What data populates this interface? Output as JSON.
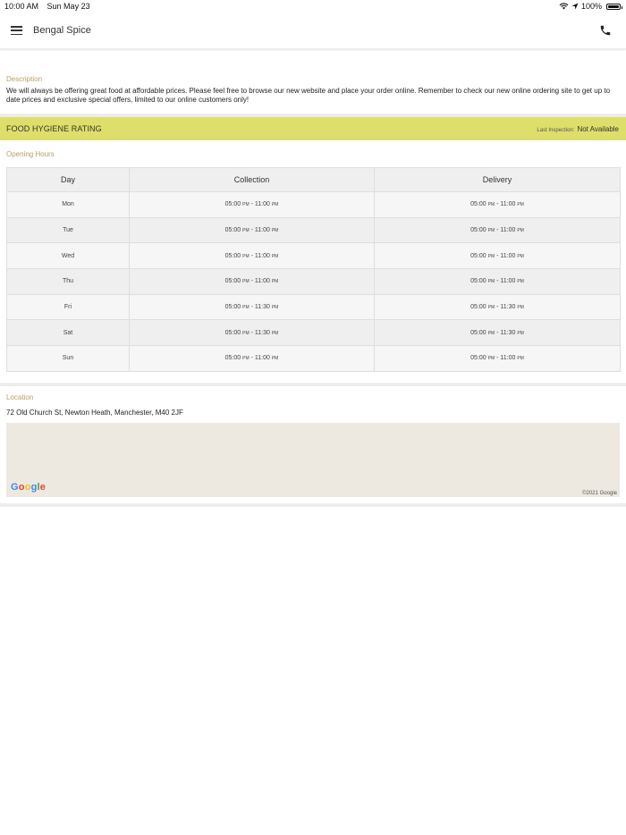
{
  "status_bar": {
    "time": "10:00 AM",
    "date": "Sun May 23",
    "battery": "100%",
    "icons": [
      "wifi-icon",
      "location-arrow-icon",
      "battery-icon"
    ]
  },
  "header": {
    "title": "Bengal Spice",
    "icons": [
      "hamburger-menu-icon",
      "phone-icon"
    ]
  },
  "description": {
    "label": "Description",
    "text": "We will always be offering great food at affordable prices. Please feel free to browse our new website and place your order online. Remember to check our new online ordering site to get up to date prices and exclusive special offers, limited to our online customers only!"
  },
  "hygiene": {
    "title": "FOOD HYGIENE RATING",
    "last_inspection_label": "Last Inspection:",
    "last_inspection_value": "Not Available"
  },
  "opening_hours": {
    "label": "Opening Hours",
    "columns": [
      "Day",
      "Collection",
      "Delivery"
    ],
    "rows": [
      {
        "day": "Mon",
        "c_start": "05:00",
        "c_end": "11:00",
        "d_start": "05:00",
        "d_end": "11:00"
      },
      {
        "day": "Tue",
        "c_start": "05:00",
        "c_end": "11:00",
        "d_start": "05:00",
        "d_end": "11:00"
      },
      {
        "day": "Wed",
        "c_start": "05:00",
        "c_end": "11:00",
        "d_start": "05:00",
        "d_end": "11:00"
      },
      {
        "day": "Thu",
        "c_start": "05:00",
        "c_end": "11:00",
        "d_start": "05:00",
        "d_end": "11:00"
      },
      {
        "day": "Fri",
        "c_start": "05:00",
        "c_end": "11:30",
        "d_start": "05:00",
        "d_end": "11:30"
      },
      {
        "day": "Sat",
        "c_start": "05:00",
        "c_end": "11:30",
        "d_start": "05:00",
        "d_end": "11:30"
      },
      {
        "day": "Sun",
        "c_start": "05:00",
        "c_end": "11:00",
        "d_start": "05:00",
        "d_end": "11:00"
      }
    ],
    "pm_label": "PM",
    "separator": "-"
  },
  "location": {
    "label": "Location",
    "address": "72 Old Church St, Newton Heath, Manchester, M40 2JF",
    "map_logo": "Google",
    "map_copyright": "©2021 Google"
  },
  "colors": {
    "hygiene_bar": "#dede6b",
    "section_label": "#b5a06a",
    "map_background": "#ede9e0"
  }
}
